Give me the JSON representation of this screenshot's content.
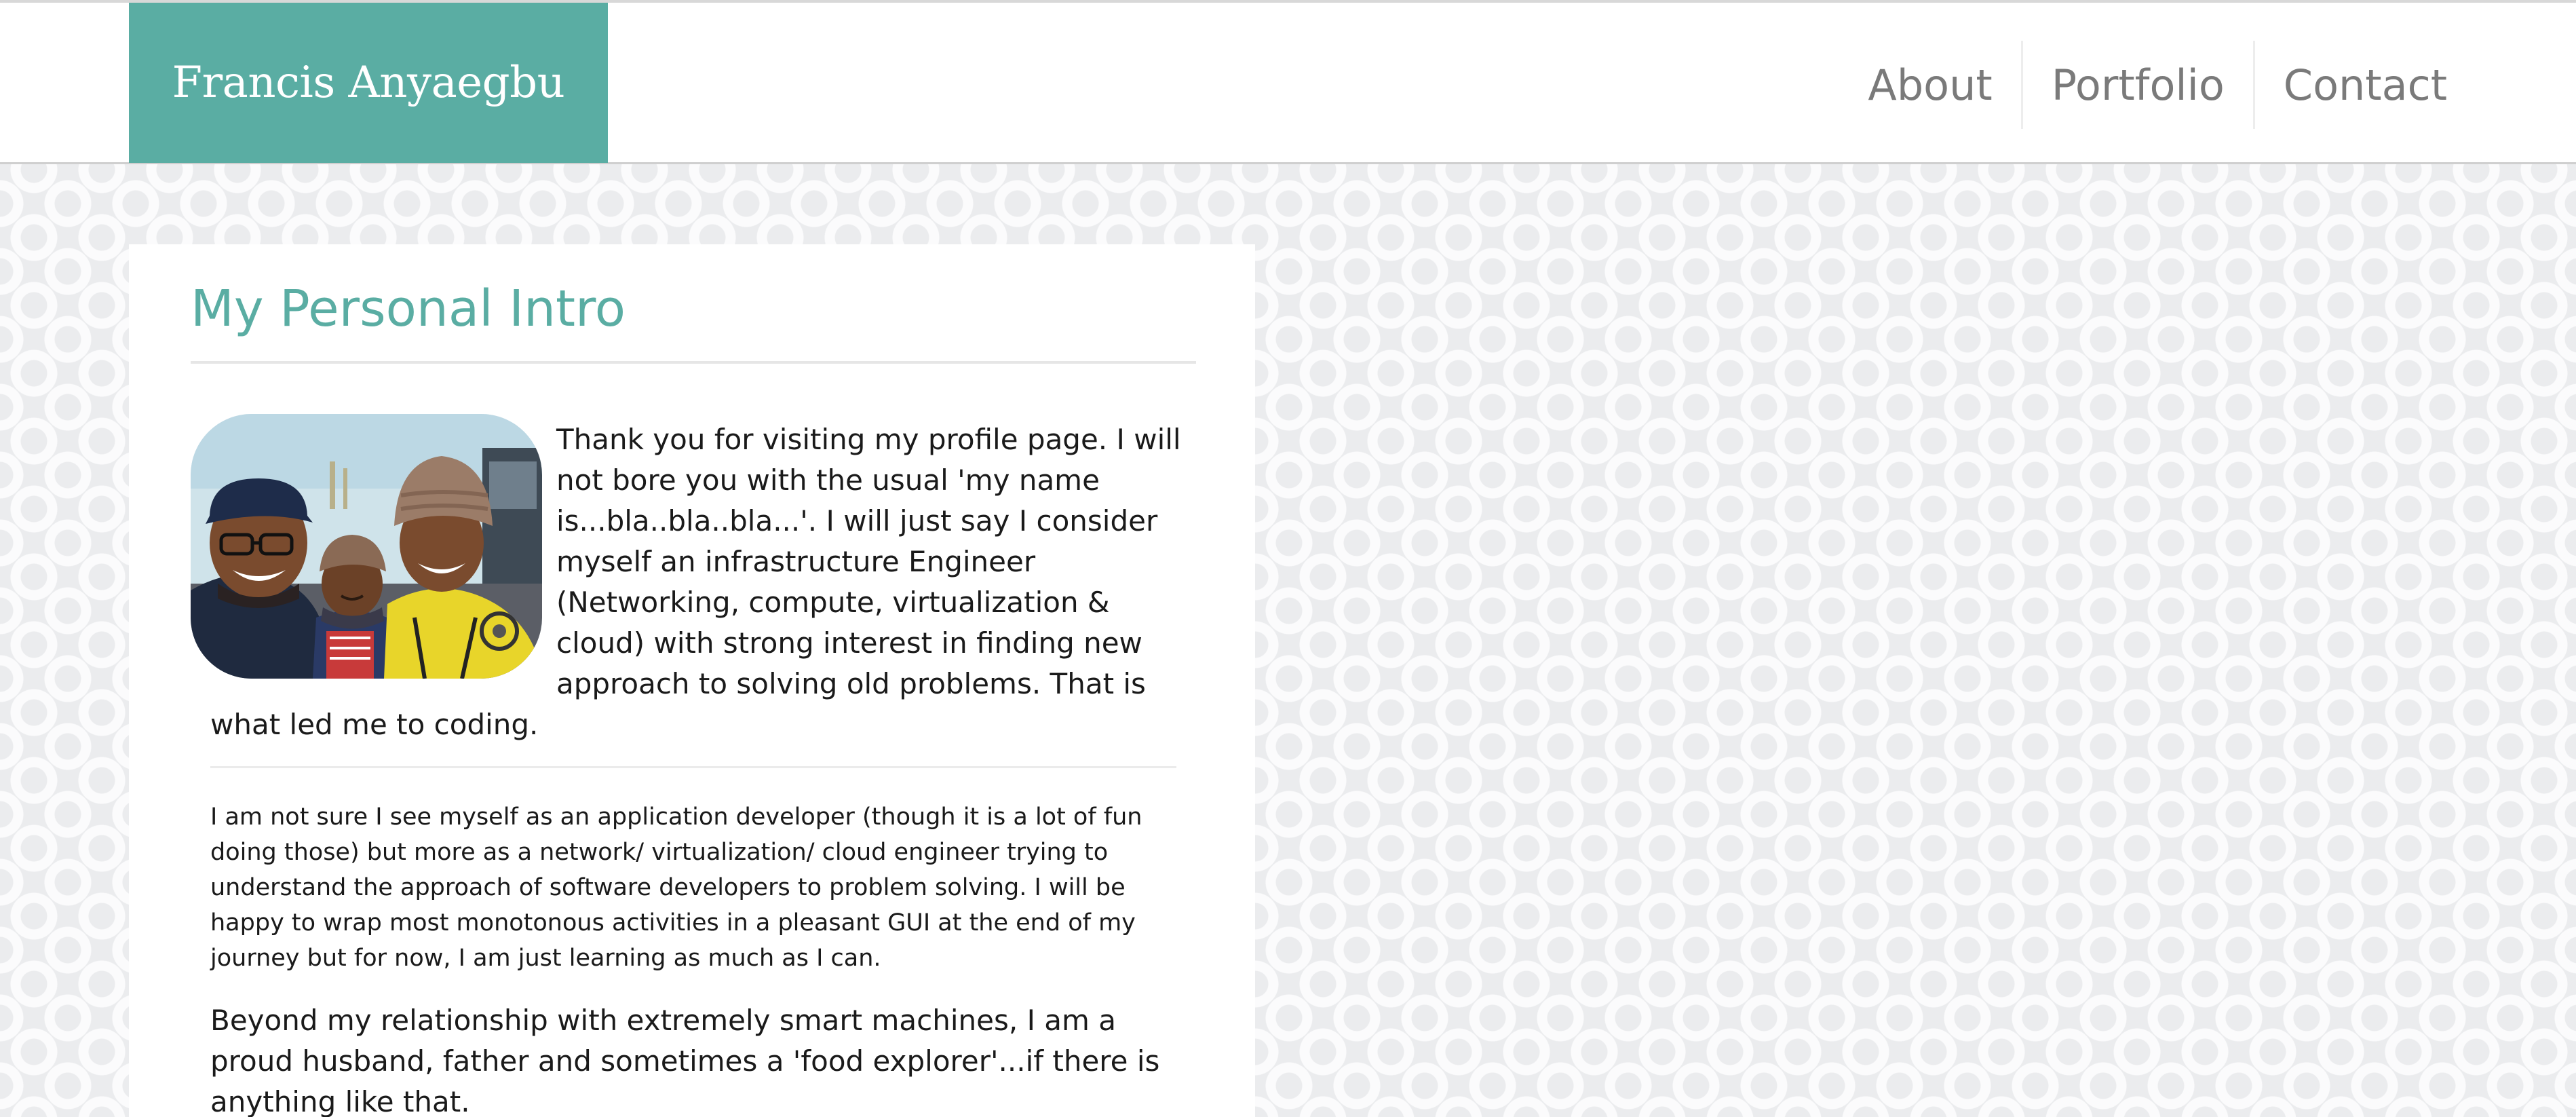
{
  "header": {
    "brand": "Francis Anyaegbu",
    "nav": [
      {
        "label": "About"
      },
      {
        "label": "Portfolio"
      },
      {
        "label": "Contact"
      }
    ]
  },
  "intro": {
    "title": "My Personal Intro",
    "photo_icon": "family-photo",
    "paragraph_1": "Thank you for visiting my profile page. I will not bore you with the usual 'my name is...bla..bla..bla...'. I will just say I consider myself an infrastructure Engineer (Networking, compute, virtualization & cloud) with strong interest in finding new approach to solving old problems. That is what led me to coding.",
    "paragraph_2": "I am not sure I see myself as an application developer (though it is a lot of fun doing those) but more as a network/ virtualization/ cloud engineer trying to understand the approach of software developers to problem solving. I will be happy to wrap most monotonous activities in a pleasant GUI at the end of my journey but for now, I am just learning as much as I can.",
    "paragraph_3": "Beyond my relationship with extremely smart machines, I am a proud husband, father and sometimes a 'food explorer'...if there is anything like that."
  },
  "colors": {
    "accent": "#5aada3",
    "nav_text": "#7a7a7a",
    "body_text": "#1a1a1a",
    "page_background": "#ebecee"
  }
}
